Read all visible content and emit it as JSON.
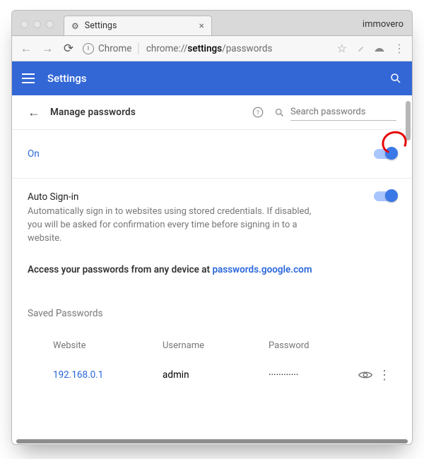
{
  "window": {
    "tab_title": "Settings",
    "profile_name": "immovero"
  },
  "omnibox": {
    "scheme_label": "Chrome",
    "url_prefix": "chrome://",
    "url_strong": "settings",
    "url_suffix": "/passwords"
  },
  "appbar": {
    "title": "Settings"
  },
  "subheader": {
    "title": "Manage passwords",
    "search_placeholder": "Search passwords"
  },
  "offer_save": {
    "label": "On",
    "state": true
  },
  "auto_signin": {
    "title": "Auto Sign-in",
    "description": "Automatically sign in to websites using stored credentials. If disabled, you will be asked for confirmation every time before signing in to a website.",
    "state": true
  },
  "remote": {
    "prefix": "Access your passwords from any device at ",
    "link_text": "passwords.google.com"
  },
  "saved": {
    "section_title": "Saved Passwords",
    "columns": {
      "website": "Website",
      "username": "Username",
      "password": "Password"
    },
    "rows": [
      {
        "website": "192.168.0.1",
        "username": "admin",
        "password_mask": "············"
      }
    ]
  },
  "colors": {
    "accent": "#3367d6",
    "link": "#2a66db"
  }
}
